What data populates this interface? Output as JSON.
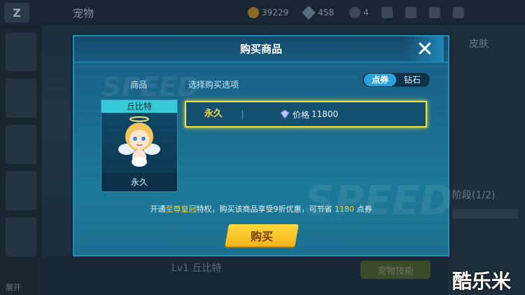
{
  "background": {
    "title": "宠物",
    "coins": "39229",
    "diamonds": "458",
    "count": "4",
    "right_tab": "皮肤",
    "right_lower_label": "阶段(1/2)",
    "bottom_level": "Lv1  丘比特",
    "bottom_button": "宠物技能",
    "expand_label": "展开"
  },
  "dialog": {
    "title": "购买商品",
    "tab_goods": "商品",
    "tab_options": "选择购买选项",
    "currency_toggle": [
      {
        "label": "点券",
        "active": true
      },
      {
        "label": "钻石",
        "active": false
      }
    ],
    "item": {
      "name": "丘比特",
      "duration": "永久"
    },
    "option": {
      "duration": "永久",
      "price_prefix": "价格",
      "price": "11800"
    },
    "promo": {
      "part1": "开通",
      "highlight1": "至尊皇冠",
      "part2": "特权，购买该商品享受9折优惠，可节省",
      "highlight2": "1180",
      "part3": "点券"
    },
    "buy_button": "购买"
  },
  "watermark_site": "酷乐米",
  "colors": {
    "accent_yellow": "#f3d545",
    "dialog_blue": "#1a6a8d",
    "toggle_active": "#2aa3dc"
  }
}
